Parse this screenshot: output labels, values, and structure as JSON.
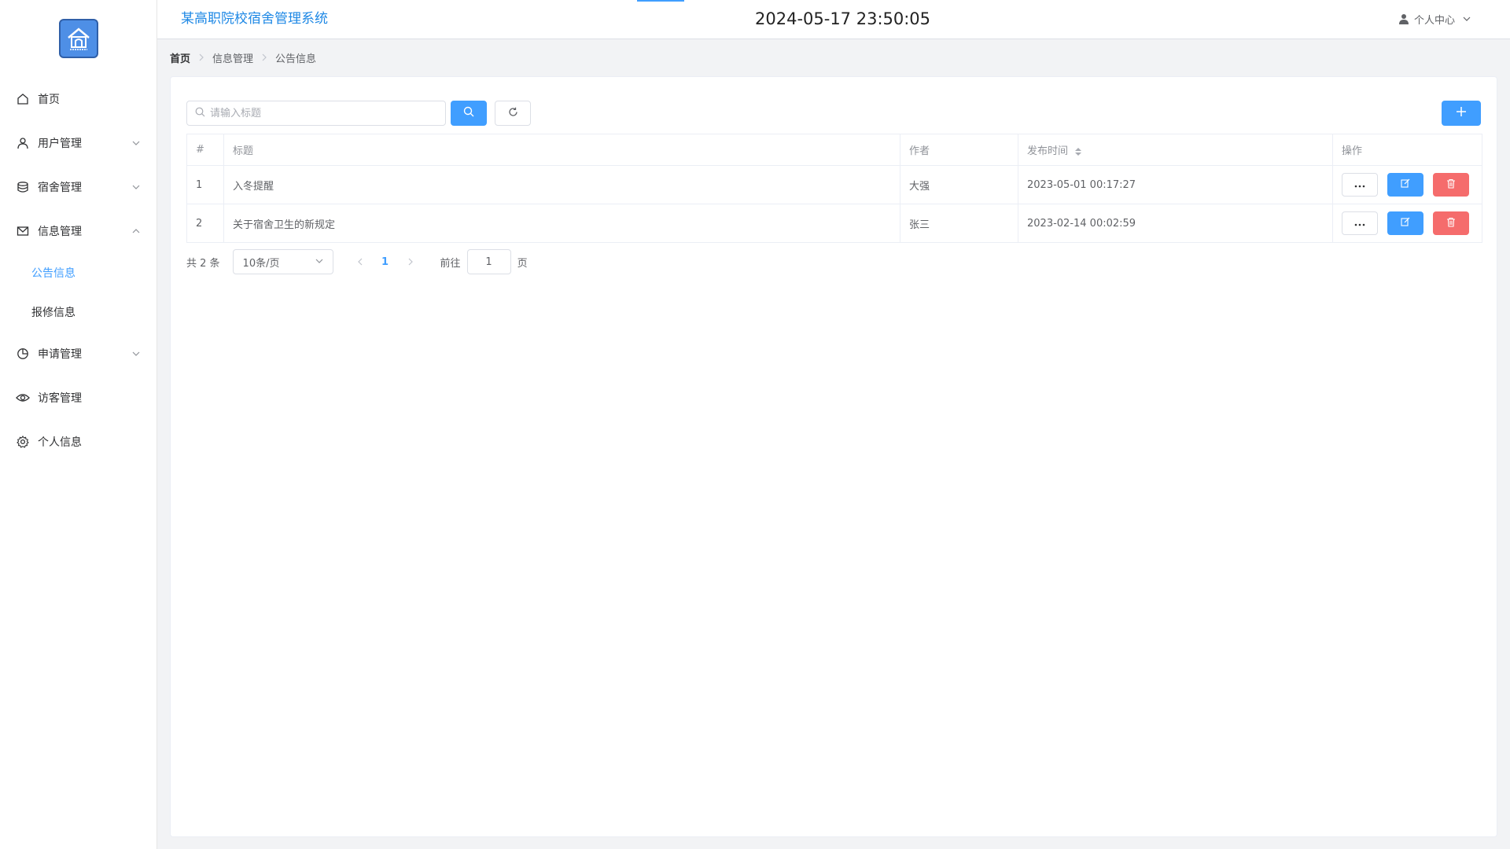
{
  "header": {
    "system_title": "某高职院校宿舍管理系统",
    "datetime": "2024-05-17 23:50:05",
    "user_center": "个人中心"
  },
  "sidebar": {
    "logo_icon": "house-icon",
    "items": [
      {
        "label": "首页",
        "icon": "home-icon"
      },
      {
        "label": "用户管理",
        "icon": "user-icon"
      },
      {
        "label": "宿舍管理",
        "icon": "database-icon"
      },
      {
        "label": "信息管理",
        "icon": "mail-icon"
      },
      {
        "label": "申请管理",
        "icon": "pie-chart-icon"
      },
      {
        "label": "访客管理",
        "icon": "eye-icon"
      },
      {
        "label": "个人信息",
        "icon": "gear-icon"
      }
    ],
    "subitems": [
      {
        "label": "公告信息",
        "active": true
      },
      {
        "label": "报修信息",
        "active": false
      }
    ],
    "active_color": "#409eff"
  },
  "breadcrumb": [
    "首页",
    "信息管理",
    "公告信息"
  ],
  "search": {
    "placeholder": "请输入标题"
  },
  "table": {
    "headers": [
      "#",
      "标题",
      "作者",
      "发布时间",
      "操作"
    ],
    "rows": [
      {
        "idx": "1",
        "title": "入冬提醒",
        "author": "大强",
        "time": "2023-05-01 00:17:27"
      },
      {
        "idx": "2",
        "title": "关于宿舍卫生的新规定",
        "author": "张三",
        "time": "2023-02-14 00:02:59"
      }
    ]
  },
  "pagination": {
    "total": "共 2 条",
    "page_size": "10条/页",
    "current_page": "1",
    "goto_label": "前往",
    "goto_value": "1",
    "page_suffix": "页"
  },
  "colors": {
    "primary": "#409eff",
    "danger": "#f56c6c",
    "title_blue": "#1e88e5"
  }
}
